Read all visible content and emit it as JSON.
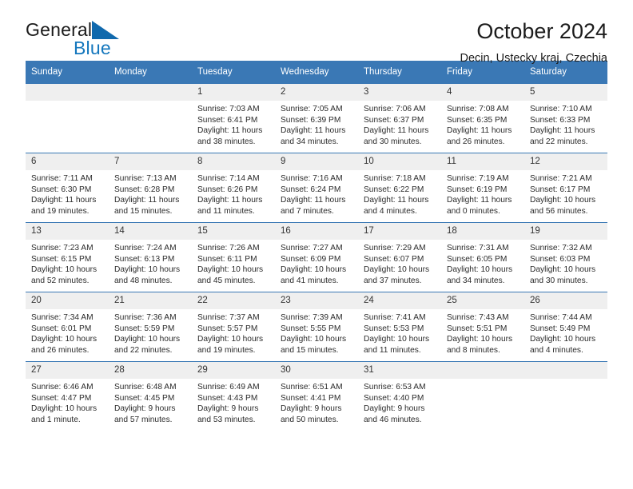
{
  "brand": {
    "word1": "General",
    "word2": "Blue",
    "triangle_color": "#1069ad",
    "blue_color": "#1477bd"
  },
  "header": {
    "title": "October 2024",
    "subtitle": "Decin, Ustecky kraj, Czechia",
    "header_bg": "#3a78b5",
    "daynum_bg": "#efefef"
  },
  "weekdays": [
    "Sunday",
    "Monday",
    "Tuesday",
    "Wednesday",
    "Thursday",
    "Friday",
    "Saturday"
  ],
  "weeks": [
    [
      {
        "day": "",
        "sunrise": "",
        "sunset": "",
        "daylight": "",
        "blank": true
      },
      {
        "day": "",
        "sunrise": "",
        "sunset": "",
        "daylight": "",
        "blank": true
      },
      {
        "day": "1",
        "sunrise": "Sunrise: 7:03 AM",
        "sunset": "Sunset: 6:41 PM",
        "daylight": "Daylight: 11 hours and 38 minutes."
      },
      {
        "day": "2",
        "sunrise": "Sunrise: 7:05 AM",
        "sunset": "Sunset: 6:39 PM",
        "daylight": "Daylight: 11 hours and 34 minutes."
      },
      {
        "day": "3",
        "sunrise": "Sunrise: 7:06 AM",
        "sunset": "Sunset: 6:37 PM",
        "daylight": "Daylight: 11 hours and 30 minutes."
      },
      {
        "day": "4",
        "sunrise": "Sunrise: 7:08 AM",
        "sunset": "Sunset: 6:35 PM",
        "daylight": "Daylight: 11 hours and 26 minutes."
      },
      {
        "day": "5",
        "sunrise": "Sunrise: 7:10 AM",
        "sunset": "Sunset: 6:33 PM",
        "daylight": "Daylight: 11 hours and 22 minutes."
      }
    ],
    [
      {
        "day": "6",
        "sunrise": "Sunrise: 7:11 AM",
        "sunset": "Sunset: 6:30 PM",
        "daylight": "Daylight: 11 hours and 19 minutes."
      },
      {
        "day": "7",
        "sunrise": "Sunrise: 7:13 AM",
        "sunset": "Sunset: 6:28 PM",
        "daylight": "Daylight: 11 hours and 15 minutes."
      },
      {
        "day": "8",
        "sunrise": "Sunrise: 7:14 AM",
        "sunset": "Sunset: 6:26 PM",
        "daylight": "Daylight: 11 hours and 11 minutes."
      },
      {
        "day": "9",
        "sunrise": "Sunrise: 7:16 AM",
        "sunset": "Sunset: 6:24 PM",
        "daylight": "Daylight: 11 hours and 7 minutes."
      },
      {
        "day": "10",
        "sunrise": "Sunrise: 7:18 AM",
        "sunset": "Sunset: 6:22 PM",
        "daylight": "Daylight: 11 hours and 4 minutes."
      },
      {
        "day": "11",
        "sunrise": "Sunrise: 7:19 AM",
        "sunset": "Sunset: 6:19 PM",
        "daylight": "Daylight: 11 hours and 0 minutes."
      },
      {
        "day": "12",
        "sunrise": "Sunrise: 7:21 AM",
        "sunset": "Sunset: 6:17 PM",
        "daylight": "Daylight: 10 hours and 56 minutes."
      }
    ],
    [
      {
        "day": "13",
        "sunrise": "Sunrise: 7:23 AM",
        "sunset": "Sunset: 6:15 PM",
        "daylight": "Daylight: 10 hours and 52 minutes."
      },
      {
        "day": "14",
        "sunrise": "Sunrise: 7:24 AM",
        "sunset": "Sunset: 6:13 PM",
        "daylight": "Daylight: 10 hours and 48 minutes."
      },
      {
        "day": "15",
        "sunrise": "Sunrise: 7:26 AM",
        "sunset": "Sunset: 6:11 PM",
        "daylight": "Daylight: 10 hours and 45 minutes."
      },
      {
        "day": "16",
        "sunrise": "Sunrise: 7:27 AM",
        "sunset": "Sunset: 6:09 PM",
        "daylight": "Daylight: 10 hours and 41 minutes."
      },
      {
        "day": "17",
        "sunrise": "Sunrise: 7:29 AM",
        "sunset": "Sunset: 6:07 PM",
        "daylight": "Daylight: 10 hours and 37 minutes."
      },
      {
        "day": "18",
        "sunrise": "Sunrise: 7:31 AM",
        "sunset": "Sunset: 6:05 PM",
        "daylight": "Daylight: 10 hours and 34 minutes."
      },
      {
        "day": "19",
        "sunrise": "Sunrise: 7:32 AM",
        "sunset": "Sunset: 6:03 PM",
        "daylight": "Daylight: 10 hours and 30 minutes."
      }
    ],
    [
      {
        "day": "20",
        "sunrise": "Sunrise: 7:34 AM",
        "sunset": "Sunset: 6:01 PM",
        "daylight": "Daylight: 10 hours and 26 minutes."
      },
      {
        "day": "21",
        "sunrise": "Sunrise: 7:36 AM",
        "sunset": "Sunset: 5:59 PM",
        "daylight": "Daylight: 10 hours and 22 minutes."
      },
      {
        "day": "22",
        "sunrise": "Sunrise: 7:37 AM",
        "sunset": "Sunset: 5:57 PM",
        "daylight": "Daylight: 10 hours and 19 minutes."
      },
      {
        "day": "23",
        "sunrise": "Sunrise: 7:39 AM",
        "sunset": "Sunset: 5:55 PM",
        "daylight": "Daylight: 10 hours and 15 minutes."
      },
      {
        "day": "24",
        "sunrise": "Sunrise: 7:41 AM",
        "sunset": "Sunset: 5:53 PM",
        "daylight": "Daylight: 10 hours and 11 minutes."
      },
      {
        "day": "25",
        "sunrise": "Sunrise: 7:43 AM",
        "sunset": "Sunset: 5:51 PM",
        "daylight": "Daylight: 10 hours and 8 minutes."
      },
      {
        "day": "26",
        "sunrise": "Sunrise: 7:44 AM",
        "sunset": "Sunset: 5:49 PM",
        "daylight": "Daylight: 10 hours and 4 minutes."
      }
    ],
    [
      {
        "day": "27",
        "sunrise": "Sunrise: 6:46 AM",
        "sunset": "Sunset: 4:47 PM",
        "daylight": "Daylight: 10 hours and 1 minute."
      },
      {
        "day": "28",
        "sunrise": "Sunrise: 6:48 AM",
        "sunset": "Sunset: 4:45 PM",
        "daylight": "Daylight: 9 hours and 57 minutes."
      },
      {
        "day": "29",
        "sunrise": "Sunrise: 6:49 AM",
        "sunset": "Sunset: 4:43 PM",
        "daylight": "Daylight: 9 hours and 53 minutes."
      },
      {
        "day": "30",
        "sunrise": "Sunrise: 6:51 AM",
        "sunset": "Sunset: 4:41 PM",
        "daylight": "Daylight: 9 hours and 50 minutes."
      },
      {
        "day": "31",
        "sunrise": "Sunrise: 6:53 AM",
        "sunset": "Sunset: 4:40 PM",
        "daylight": "Daylight: 9 hours and 46 minutes."
      },
      {
        "day": "",
        "sunrise": "",
        "sunset": "",
        "daylight": "",
        "blank": true
      },
      {
        "day": "",
        "sunrise": "",
        "sunset": "",
        "daylight": "",
        "blank": true
      }
    ]
  ]
}
